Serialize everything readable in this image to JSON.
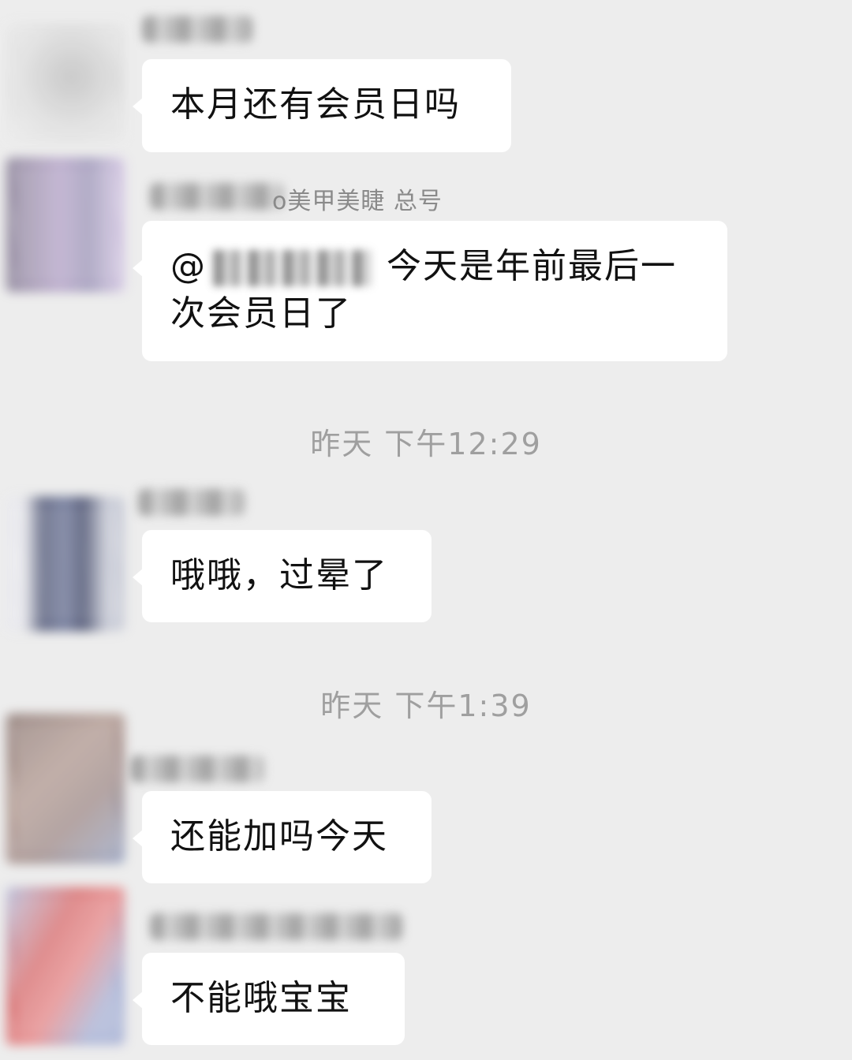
{
  "chat": {
    "messages": [
      {
        "text": "本月还有会员日吗"
      },
      {
        "sender_suffix": "o美甲美睫 总号",
        "mention_prefix": "@",
        "text_line1": "今天是年前最后一",
        "text_line2": "次会员日了"
      },
      {
        "text": "哦哦，过晕了"
      },
      {
        "text": "还能加吗今天"
      },
      {
        "text": "不能哦宝宝"
      }
    ],
    "timestamps": [
      "昨天 下午12:29",
      "昨天 下午1:39"
    ]
  }
}
